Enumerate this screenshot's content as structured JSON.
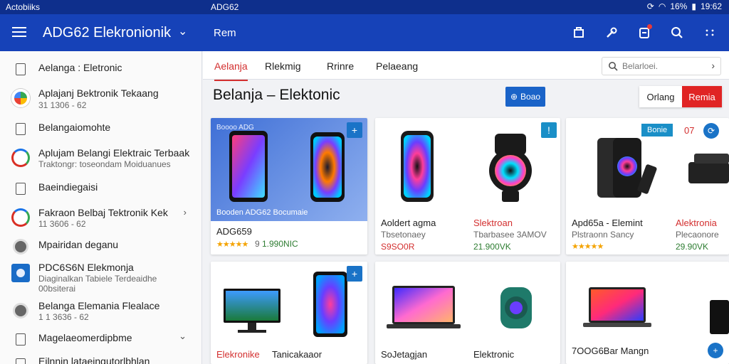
{
  "status_bar": {
    "left_text": "Actobiiks",
    "center_text": "ADG62",
    "battery_text": "16%",
    "time": "19:62"
  },
  "app_bar": {
    "title": "ADG62 Elekronionik",
    "tab_label": "Rem",
    "actions": [
      "cart-icon",
      "tools-icon",
      "notification-icon",
      "search-icon",
      "more-icon"
    ]
  },
  "sidebar": {
    "items": [
      {
        "label": "Aelanga : Eletronic",
        "icon": "document-icon"
      },
      {
        "label": "Aplajanj Bektronik Tekaang",
        "sub": "31 1306 - 62",
        "icon": "app-icon"
      },
      {
        "label": "Belangaiomohte",
        "icon": "document-icon"
      },
      {
        "label": "Aplujam Belangi Elektraic Terbaak",
        "sub": "Traktongr: toseondam Moiduanues",
        "icon": "ring-icon"
      },
      {
        "label": "Baeindiegaisi",
        "icon": "document-icon"
      },
      {
        "label": "Fakraon Belbaj Tektronik Kek",
        "sub": "11 3606 - 62",
        "icon": "ring-icon",
        "chevron": "›"
      },
      {
        "label": "Mpairidan deganu",
        "icon": "dot-icon"
      },
      {
        "label": "PDC6S6N Elekmonja",
        "sub": "Diaginalkan Tabiele Terdeaidhe",
        "sub2": "00bsiterai",
        "icon": "blue-square-icon"
      },
      {
        "label": "Belanga Elemania Flealace",
        "sub": "1 1 3636 - 62",
        "icon": "dot-icon"
      },
      {
        "label": "Magelaeomerdipbme",
        "icon": "document-icon",
        "chevron": "⌄"
      },
      {
        "label": "Eilnnin lataeingutorlbhlan",
        "icon": "document-icon"
      }
    ]
  },
  "tabs": [
    "Aelanja",
    "Rlekmig",
    "Rrinre",
    "Pelaeang"
  ],
  "search": {
    "placeholder": "Belarloei."
  },
  "page_title": "Belanja – Elektonic",
  "primary_button": "Boao",
  "segmented": {
    "option_a": "Orlang",
    "option_b": "Remia"
  },
  "hero_card": {
    "tag": "Boooo ADG",
    "caption": "Booden ADG62 Bocumaie",
    "name": "ADG659",
    "rating": "★★★★★",
    "rating_count": "9",
    "price": "1.990NIC"
  },
  "products_row1": [
    {
      "name": "Aoldert agma",
      "sub": "Tbsetonaey",
      "price": "S9SO0R",
      "price_color": "red"
    },
    {
      "name": "Slektroan",
      "sub": "Tbarbasee 3AMOV",
      "price": "21.900VK",
      "price_color": "green",
      "name_color": "red"
    },
    {
      "name": "Apd65a - Elemint",
      "sub": "Plstraonn Sancy",
      "price": "",
      "badge": "Bonie",
      "stars": "★★★★★"
    },
    {
      "name": "Alektronia",
      "sub": "Plecaonore",
      "price": "29.90VK",
      "price_color": "green",
      "name_color": "red",
      "tag": "07"
    }
  ],
  "products_row2": [
    {
      "name": "Elekronike",
      "sub": "Tanicakaaor",
      "color": "red"
    },
    {
      "name": "SoJetagjan",
      "sub": ""
    },
    {
      "name": "Elektronic",
      "sub": ""
    },
    {
      "name": "7OOG6Bar Mangn",
      "sub": ""
    }
  ]
}
